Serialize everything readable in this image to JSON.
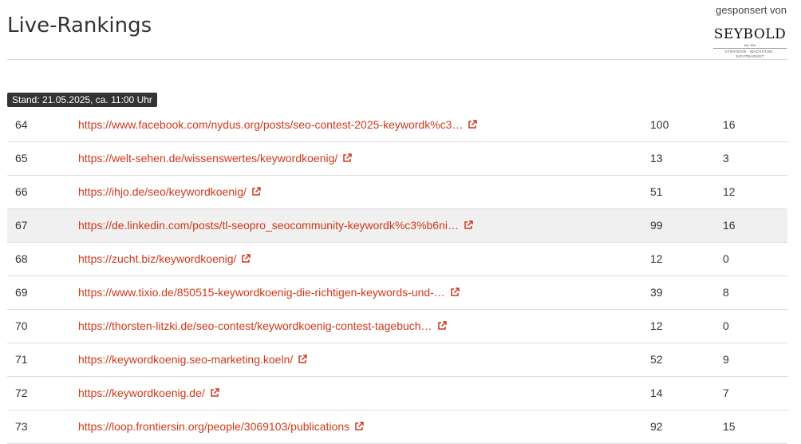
{
  "header": {
    "title": "Live-Rankings",
    "sponsor_label": "gesponsert von",
    "logo": {
      "name": "SEYBOLD",
      "est": "est. 19••",
      "tagline": "STRATEGIE · WACHSTUM · SICHTBARKEIT"
    }
  },
  "stand": "Stand: 21.05.2025, ca. 11:00 Uhr",
  "rows": [
    {
      "rank": "64",
      "url": "https://www.facebook.com/nydus.org/posts/seo-contest-2025-keywordk%c3…",
      "v1": "100",
      "v2": "16"
    },
    {
      "rank": "65",
      "url": "https://welt-sehen.de/wissenswertes/keywordkoenig/",
      "v1": "13",
      "v2": "3"
    },
    {
      "rank": "66",
      "url": "https://ihjo.de/seo/keywordkoenig/",
      "v1": "51",
      "v2": "12"
    },
    {
      "rank": "67",
      "url": "https://de.linkedin.com/posts/tl-seopro_seocommunity-keywordk%c3%b6ni…",
      "v1": "99",
      "v2": "16"
    },
    {
      "rank": "68",
      "url": "https://zucht.biz/keywordkoenig/",
      "v1": "12",
      "v2": "0"
    },
    {
      "rank": "69",
      "url": "https://www.tixio.de/850515-keywordkoenig-die-richtigen-keywords-und-…",
      "v1": "39",
      "v2": "8"
    },
    {
      "rank": "70",
      "url": "https://thorsten-litzki.de/seo-contest/keywordkoenig-contest-tagebuch…",
      "v1": "12",
      "v2": "0"
    },
    {
      "rank": "71",
      "url": "https://keywordkoenig.seo-marketing.koeln/",
      "v1": "52",
      "v2": "9"
    },
    {
      "rank": "72",
      "url": "https://keywordkoenig.de/",
      "v1": "14",
      "v2": "7"
    },
    {
      "rank": "73",
      "url": "https://loop.frontiersin.org/people/3069103/publications",
      "v1": "92",
      "v2": "15"
    }
  ],
  "colors": {
    "link": "#d0381a",
    "badge_bg": "#333333",
    "highlight_row": "#f0f0f0"
  },
  "icons": {
    "external": "external-link-icon"
  }
}
